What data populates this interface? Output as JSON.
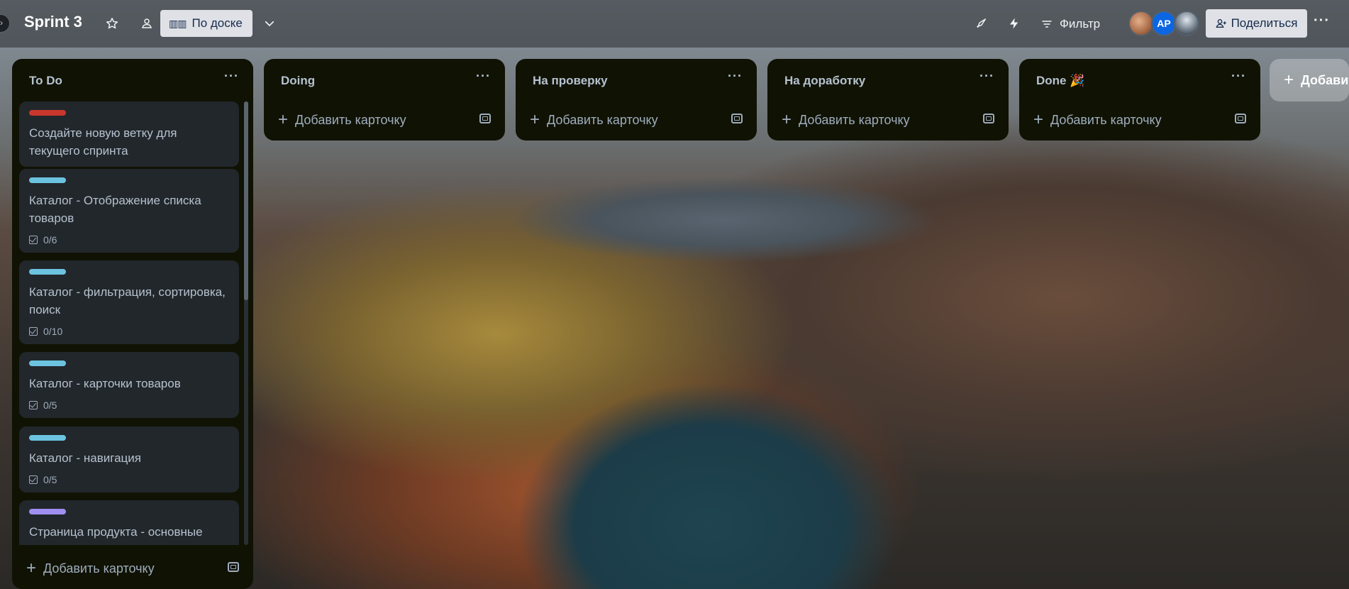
{
  "header": {
    "board_title": "Sprint 3",
    "view_label": "По доске",
    "filter_label": "Фильтр",
    "share_label": "Поделиться",
    "avatar_initials": "AP",
    "more_label": "···"
  },
  "lists": {
    "todo": {
      "title": "To Do",
      "menu": "···",
      "add_card": "Добавить карточку",
      "cards": [
        {
          "title": "Создайте новую ветку для текущего спринта",
          "label_color": "#c9372c",
          "checklist": ""
        },
        {
          "title": "Каталог - Отображение списка товаров",
          "label_color": "#6cc3e0",
          "checklist": "0/6"
        },
        {
          "title": "Каталог - фильтрация, сортировка, поиск",
          "label_color": "#6cc3e0",
          "checklist": "0/10"
        },
        {
          "title": "Каталог - карточки товаров",
          "label_color": "#6cc3e0",
          "checklist": "0/5"
        },
        {
          "title": "Каталог - навигация",
          "label_color": "#6cc3e0",
          "checklist": "0/5"
        },
        {
          "title": "Страница продукта - основные элементы",
          "label_color": "#9f8fef",
          "checklist": ""
        }
      ]
    },
    "doing": {
      "title": "Doing",
      "menu": "···",
      "add_card": "Добавить карточку"
    },
    "review": {
      "title": "На проверку",
      "menu": "···",
      "add_card": "Добавить карточку"
    },
    "rework": {
      "title": "На доработку",
      "menu": "···",
      "add_card": "Добавить карточку"
    },
    "done": {
      "title": "Done 🎉",
      "menu": "···",
      "add_card": "Добавить карточку"
    }
  },
  "add_list_label": "Добавить"
}
